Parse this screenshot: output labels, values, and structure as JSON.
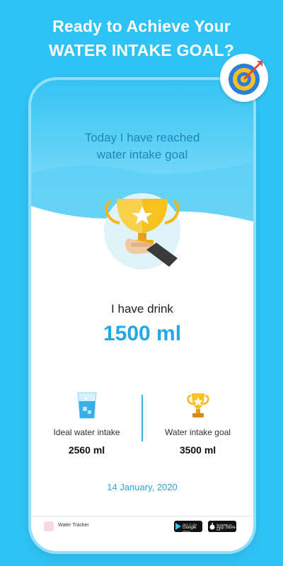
{
  "headline": {
    "line1": "Ready to Achieve Your",
    "line2": "WATER INTAKE GOAL?"
  },
  "badge_icon": "target-bullseye-icon",
  "screen": {
    "reached_line1": "Today I have reached",
    "reached_line2": "water intake goal",
    "trophy_icon": "trophy-in-hand-icon",
    "drink_label": "I have drink",
    "drink_value": "1500 ml",
    "stats": [
      {
        "icon": "water-glass-icon",
        "label": "Ideal water intake",
        "value": "2560 ml"
      },
      {
        "icon": "trophy-icon",
        "label": "Water intake goal",
        "value": "3500 ml"
      }
    ],
    "date": "14 January, 2020"
  },
  "footer": {
    "app_name": "Water Tracker",
    "google_small": "GET IT ON",
    "google_big": "Google play",
    "apple_small": "Available on the",
    "apple_big": "App Store"
  },
  "colors": {
    "background": "#2fc3f5",
    "accent": "#22a8e4",
    "wave_light": "#7fdcf8",
    "trophy_gold": "#f5b616"
  }
}
